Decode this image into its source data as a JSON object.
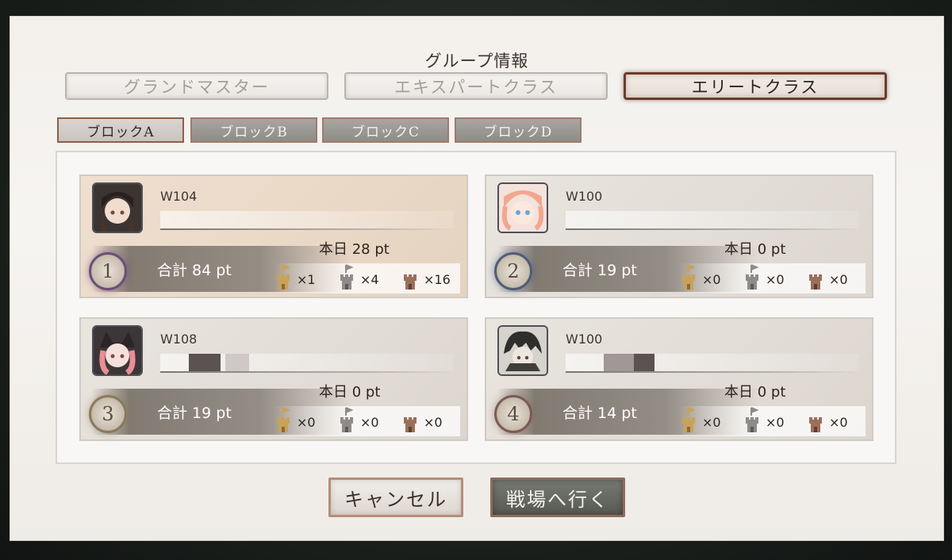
{
  "dialog": {
    "title": "グループ情報",
    "class_tabs": [
      {
        "label": "グランドマスター",
        "active": false
      },
      {
        "label": "エキスパートクラス",
        "active": false
      },
      {
        "label": "エリートクラス",
        "active": true
      }
    ],
    "block_tabs": [
      {
        "label": "ブロックA",
        "active": true
      },
      {
        "label": "ブロックB",
        "active": false
      },
      {
        "label": "ブロックC",
        "active": false
      },
      {
        "label": "ブロックD",
        "active": false
      }
    ],
    "players": [
      {
        "rank": "1",
        "guild": "W104",
        "today": "本日 28 pt",
        "total": "合計 84 pt",
        "towers": [
          {
            "icon": "gold-tower-icon",
            "count": "×1"
          },
          {
            "icon": "silver-tower-icon",
            "count": "×4"
          },
          {
            "icon": "bronze-tower-icon",
            "count": "×16"
          }
        ]
      },
      {
        "rank": "2",
        "guild": "W100",
        "today": "本日 0 pt",
        "total": "合計 19 pt",
        "towers": [
          {
            "icon": "gold-tower-icon",
            "count": "×0"
          },
          {
            "icon": "silver-tower-icon",
            "count": "×0"
          },
          {
            "icon": "bronze-tower-icon",
            "count": "×0"
          }
        ]
      },
      {
        "rank": "3",
        "guild": "W108",
        "today": "本日 0 pt",
        "total": "合計 19 pt",
        "towers": [
          {
            "icon": "gold-tower-icon",
            "count": "×0"
          },
          {
            "icon": "silver-tower-icon",
            "count": "×0"
          },
          {
            "icon": "bronze-tower-icon",
            "count": "×0"
          }
        ]
      },
      {
        "rank": "4",
        "guild": "W100",
        "today": "本日 0 pt",
        "total": "合計 14 pt",
        "towers": [
          {
            "icon": "gold-tower-icon",
            "count": "×0"
          },
          {
            "icon": "silver-tower-icon",
            "count": "×0"
          },
          {
            "icon": "bronze-tower-icon",
            "count": "×0"
          }
        ]
      }
    ],
    "buttons": {
      "cancel": "キャンセル",
      "go": "戦場へ行く"
    }
  },
  "colors": {
    "gold": "#c9a25a",
    "silver": "#8e8b88",
    "bronze": "#9c6f5a",
    "active_tab_border": "#6e3b2c"
  }
}
